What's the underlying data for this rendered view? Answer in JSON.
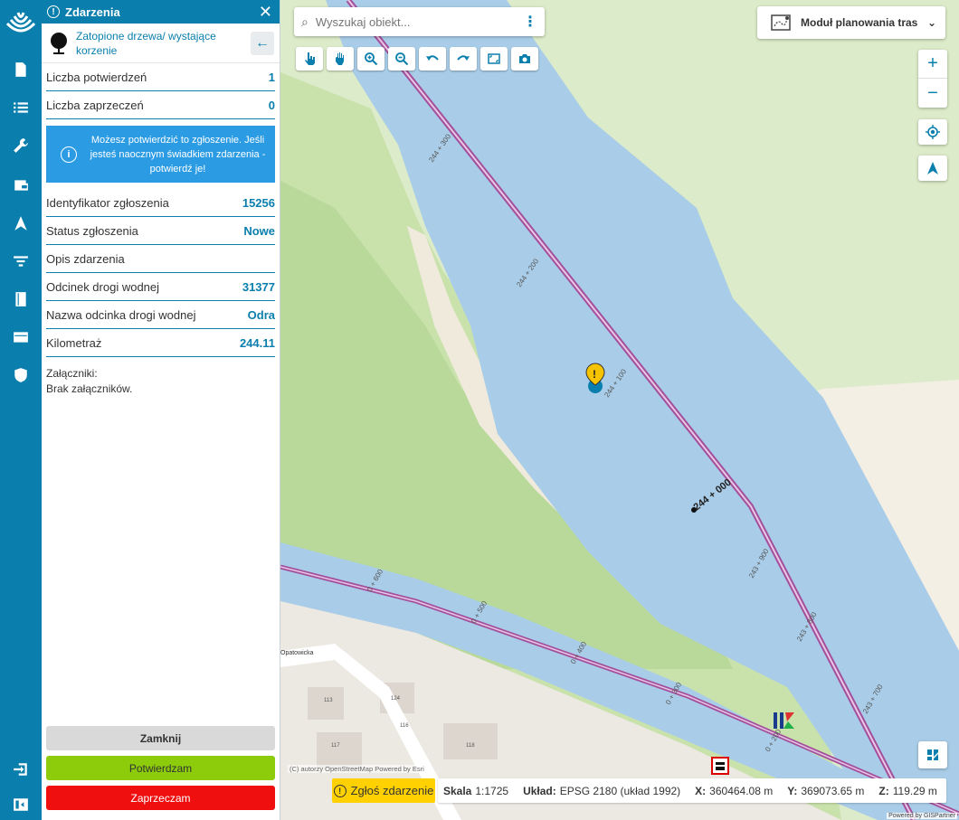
{
  "panel": {
    "title": "Zdarzenia",
    "event_type": "Zatopione drzewa/ wystające korzenie",
    "rows_top": [
      {
        "label": "Liczba potwierdzeń",
        "value": "1"
      },
      {
        "label": "Liczba zaprzeczeń",
        "value": "0"
      }
    ],
    "info": "Możesz potwierdzić to zgłoszenie. Jeśli jesteś naocznym świadkiem zdarzenia - potwierdź je!",
    "rows": [
      {
        "label": "Identyfikator zgłoszenia",
        "value": "15256"
      },
      {
        "label": "Status zgłoszenia",
        "value": "Nowe"
      },
      {
        "label": "Opis zdarzenia",
        "value": ""
      },
      {
        "label": "Odcinek drogi wodnej",
        "value": "31377"
      },
      {
        "label": "Nazwa odcinka drogi wodnej",
        "value": "Odra"
      },
      {
        "label": "Kilometraż",
        "value": "244.11"
      }
    ],
    "attachments_label": "Załączniki:",
    "attachments_value": "Brak załączników.",
    "btn_close": "Zamknij",
    "btn_confirm": "Potwierdzam",
    "btn_deny": "Zaprzeczam"
  },
  "map": {
    "search_placeholder": "Wyszukaj obiekt...",
    "route_module": "Moduł planowania tras",
    "attribution": "(C) autorzy OpenStreetMap   Powered by Esri",
    "powered": "Powered by GISPartner",
    "report_button": "Zgłoś zdarzenie",
    "km_labels": [
      "244 + 300",
      "244 + 200",
      "244 + 100",
      "244 + 000",
      "243 + 900",
      "243 + 800",
      "243 + 700",
      "0 + 600",
      "0 + 500",
      "0 + 400",
      "0 + 300",
      "0 + 200"
    ],
    "street": "Opatowicka",
    "house_numbers": [
      "113",
      "124",
      "116",
      "117",
      "118"
    ],
    "status": {
      "scale_label": "Skala",
      "scale_value": "1:1725",
      "crs_label": "Układ:",
      "crs_value": "EPSG 2180 (układ 1992)",
      "x_label": "X:",
      "x_value": "360464.08 m",
      "y_label": "Y:",
      "y_value": "369073.65 m",
      "z_label": "Z:",
      "z_value": "119.29 m"
    }
  }
}
